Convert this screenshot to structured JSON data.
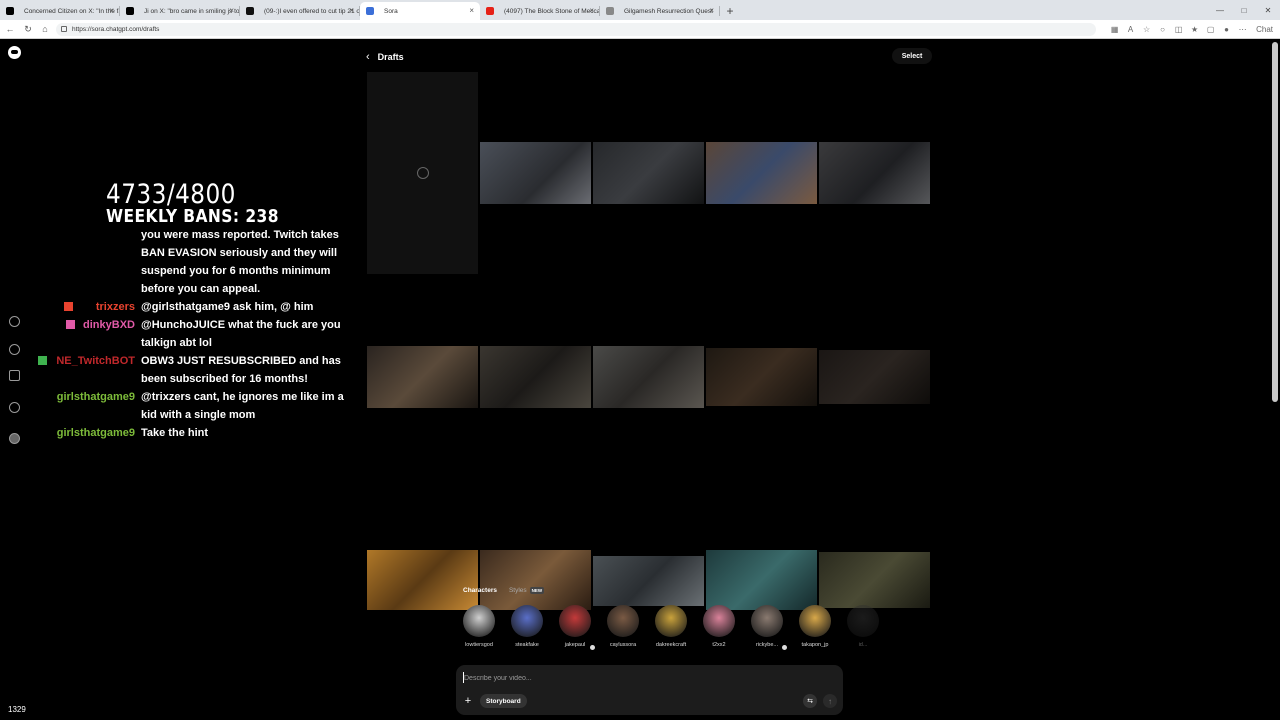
{
  "browser": {
    "tabs": [
      {
        "title": "Concerned Citizen on X: \"In the fa",
        "favicon": "#000000",
        "active": false
      },
      {
        "title": "Ji on X: \"bro came in smiling js to",
        "favicon": "#000000",
        "active": false
      },
      {
        "title": "(09-:)I even offered to cut tip 21 o",
        "favicon": "#111111",
        "active": false
      },
      {
        "title": "Sora",
        "favicon": "#3b6fd8",
        "active": true
      },
      {
        "title": "(4097) The Block Stone of Mecca",
        "favicon": "#e62117",
        "active": false
      },
      {
        "title": "Gilgamesh Resurrection Quest",
        "favicon": "#888888",
        "active": false
      }
    ],
    "new_tab": "+",
    "url": "https://sora.chatgpt.com/drafts",
    "chat_button": "Chat"
  },
  "stream_overlay": {
    "counter_main": "4733/4800",
    "counter_sub": "WEEKLY BANS: 238",
    "viewer_count": "1329"
  },
  "chat": [
    {
      "name": "",
      "name_color": "#ffffff",
      "text": "you were mass reported. Twitch takes",
      "badge": ""
    },
    {
      "name": "",
      "name_color": "#ffffff",
      "text": "BAN EVASION seriously and they will",
      "badge": ""
    },
    {
      "name": "",
      "name_color": "#ffffff",
      "text": "suspend you for 6 months minimum",
      "badge": ""
    },
    {
      "name": "",
      "name_color": "#ffffff",
      "text": "before you can appeal.",
      "badge": ""
    },
    {
      "name": "trixzers",
      "name_color": "#e8432f",
      "text": "@girlsthatgame9 ask him, @ him",
      "badge": "red"
    },
    {
      "name": "dinkyBXD",
      "name_color": "#e05aa8",
      "text": "@HunchoJUICE what the fuck are you",
      "badge": "warn"
    },
    {
      "name": "",
      "name_color": "#ffffff",
      "text": "talkign abt lol",
      "badge": ""
    },
    {
      "name": "NE_TwitchBOT",
      "name_color": "#c0282b",
      "text": "OBW3 JUST RESUBSCRIBED and has",
      "badge": "green"
    },
    {
      "name": "",
      "name_color": "#ffffff",
      "text": "been subscribed for 16 months!",
      "badge": ""
    },
    {
      "name": "girlsthatgame9",
      "name_color": "#7dbb3a",
      "text": "@trixzers cant, he ignores me like im a",
      "badge": ""
    },
    {
      "name": "",
      "name_color": "#ffffff",
      "text": "kid with a single mom",
      "badge": ""
    },
    {
      "name": "girlsthatgame9",
      "name_color": "#7dbb3a",
      "text": "Take the hint",
      "badge": ""
    }
  ],
  "sora": {
    "title": "Drafts",
    "select_label": "Select",
    "character_tabs": [
      {
        "label": "Characters",
        "active": true,
        "badge": ""
      },
      {
        "label": "Styles",
        "active": false,
        "badge": "NEW"
      }
    ],
    "characters": [
      {
        "name": "lowtiersgod",
        "color": "#cfcfcf",
        "verified": false
      },
      {
        "name": "steakfake",
        "color": "#5a6fc8",
        "verified": false
      },
      {
        "name": "jakepaul",
        "color": "#c33a3a",
        "verified": true
      },
      {
        "name": "caylussora",
        "color": "#7a5a44",
        "verified": false
      },
      {
        "name": "dakreekcraft",
        "color": "#c9a23c",
        "verified": false
      },
      {
        "name": "t2xx2",
        "color": "#d9829a",
        "verified": false
      },
      {
        "name": "rickybe...",
        "color": "#8a7a70",
        "verified": true
      },
      {
        "name": "takapon_jp",
        "color": "#d8a84a",
        "verified": false
      },
      {
        "name": "id...",
        "color": "#444444",
        "verified": false
      }
    ],
    "composer": {
      "placeholder": "Describe your video...",
      "storyboard_label": "Storyboard",
      "add_icon": "plus-icon",
      "settings_icon": "sliders-icon",
      "send_icon": "arrow-up-icon"
    }
  }
}
